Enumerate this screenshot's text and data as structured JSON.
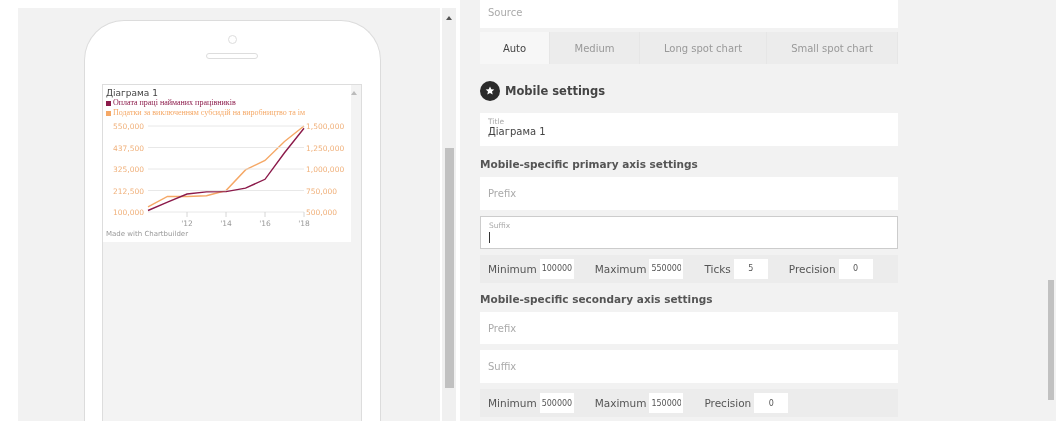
{
  "preview": {
    "chart_card": {
      "title": "Діаграма 1",
      "charts": [
        {
          "chart_data": {
            "type": "line",
            "x": [
              2010,
              2011,
              2012,
              2013,
              2014,
              2015,
              2016,
              2017,
              2018
            ],
            "xlim": [
              2010,
              2018
            ],
            "grid": true,
            "xticks": [
              {
                "value": 2012,
                "label": "'12"
              },
              {
                "value": 2014,
                "label": "'14"
              },
              {
                "value": 2016,
                "label": "'16"
              },
              {
                "value": 2018,
                "label": "'18"
              }
            ],
            "ylim": [
              100000,
              550000
            ],
            "yticks": [
              {
                "value": 100000,
                "label": "100,000"
              },
              {
                "value": 212500,
                "label": "212,500"
              },
              {
                "value": 325000,
                "label": "325,000"
              },
              {
                "value": 437500,
                "label": "437,500"
              },
              {
                "value": 550000,
                "label": "550,000"
              }
            ],
            "series": [
              {
                "name": "Оплата праці найманих працівників",
                "color": "#8b1a4a",
                "values": [
                  108000,
                  152000,
                  194000,
                  205000,
                  207000,
                  225000,
                  271000,
                  410000,
                  538000
                ]
              }
            ]
          }
        },
        {
          "chart_data": {
            "type": "line",
            "ylim": [
              500000,
              1500000
            ],
            "yticks": [
              {
                "value": 500000,
                "label": "500,000"
              },
              {
                "value": 750000,
                "label": "750,000"
              },
              {
                "value": 1000000,
                "label": "1,000,000"
              },
              {
                "value": 1250000,
                "label": "1,250,000"
              },
              {
                "value": 1500000,
                "label": "1,500,000"
              }
            ],
            "series": [
              {
                "name": "Податки за виключенням субсидій на виробництво та ім",
                "color": "#f5a866",
                "values": [
                  560000,
                  680000,
                  680000,
                  690000,
                  750000,
                  990000,
                  1100000,
                  1320000,
                  1500000
                ]
              }
            ]
          }
        }
      ],
      "credit": "Made with Chartbuilder"
    }
  },
  "settings": {
    "source": {
      "placeholder": "Source"
    },
    "size_tabs": [
      {
        "label": "Auto",
        "selected": true
      },
      {
        "label": "Medium",
        "selected": false
      },
      {
        "label": "Long spot chart",
        "selected": false
      },
      {
        "label": "Small spot chart",
        "selected": false
      }
    ],
    "mobile_heading": "Mobile settings",
    "title_field": {
      "label": "Title",
      "value": "Діаграма 1"
    },
    "axes": [
      {
        "heading": "Mobile-specific primary axis settings",
        "prefix": {
          "placeholder": "Prefix"
        },
        "suffix": {
          "label": "Suffix",
          "focused": true
        },
        "limits": [
          {
            "label": "Minimum",
            "value": "100000"
          },
          {
            "label": "Maximum",
            "value": "550000"
          },
          {
            "label": "Ticks",
            "value": "5"
          },
          {
            "label": "Precision",
            "value": "0"
          }
        ]
      },
      {
        "heading": "Mobile-specific secondary axis settings",
        "prefix": {
          "placeholder": "Prefix"
        },
        "suffix": {
          "placeholder": "Suffix",
          "focused": false
        },
        "limits": [
          {
            "label": "Minimum",
            "value": "500000"
          },
          {
            "label": "Maximum",
            "value": "150000"
          },
          {
            "label": "Precision",
            "value": "0"
          }
        ]
      }
    ]
  }
}
